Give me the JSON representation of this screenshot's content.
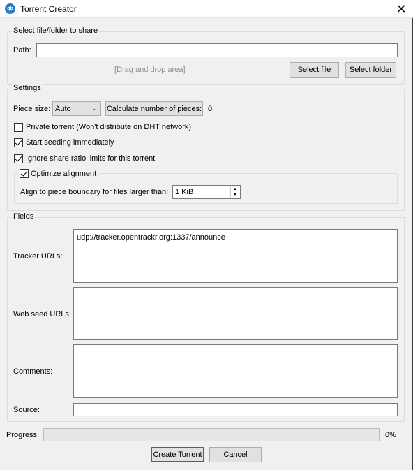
{
  "window": {
    "title": "Torrent Creator",
    "app_icon_text": "qb",
    "close_glyph": "✕"
  },
  "file_section": {
    "legend": "Select file/folder to share",
    "path_label": "Path:",
    "path_value": "",
    "drop_area": "[Drag and drop area]",
    "select_file": "Select file",
    "select_folder": "Select folder"
  },
  "settings": {
    "legend": "Settings",
    "piece_size_label": "Piece size:",
    "piece_size_value": "Auto",
    "calc_button": "Calculate number of pieces:",
    "pieces_count": "0",
    "private_label": "Private torrent (Won't distribute on DHT network)",
    "private_checked": false,
    "seed_label": "Start seeding immediately",
    "seed_checked": true,
    "ignore_label": "Ignore share ratio limits for this torrent",
    "ignore_checked": true,
    "optimize_label": "Optimize alignment",
    "optimize_checked": true,
    "align_label": "Align to piece boundary for files larger than:",
    "align_value": "1 KiB"
  },
  "fields": {
    "legend": "Fields",
    "tracker_label": "Tracker URLs:",
    "tracker_value": "udp://tracker.opentrackr.org:1337/announce",
    "webseed_label": "Web seed URLs:",
    "webseed_value": "",
    "comments_label": "Comments:",
    "comments_value": "",
    "source_label": "Source:",
    "source_value": ""
  },
  "progress": {
    "label": "Progress:",
    "value_text": "0%",
    "fraction": 0
  },
  "actions": {
    "create": "Create Torrent",
    "cancel": "Cancel"
  }
}
